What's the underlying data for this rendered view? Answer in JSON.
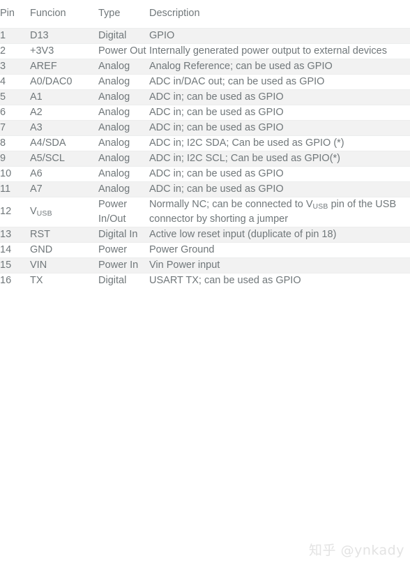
{
  "table": {
    "name": "arduino-pin-description-table",
    "columns": [
      {
        "key": "pin",
        "label": "Pin"
      },
      {
        "key": "func",
        "label": "Funcion"
      },
      {
        "key": "type",
        "label": "Type"
      },
      {
        "key": "desc",
        "label": "Description"
      }
    ],
    "rows": [
      {
        "pin": "1",
        "func": "D13",
        "type": "Digital",
        "desc": "GPIO"
      },
      {
        "pin": "2",
        "func": "+3V3",
        "type": "Power Out",
        "desc": "Internally generated power output to external devices"
      },
      {
        "pin": "3",
        "func": "AREF",
        "type": "Analog",
        "desc": "Analog Reference; can be used as GPIO"
      },
      {
        "pin": "4",
        "func": "A0/DAC0",
        "type": "Analog",
        "desc": "ADC in/DAC out; can be used as GPIO"
      },
      {
        "pin": "5",
        "func": "A1",
        "type": "Analog",
        "desc": "ADC in; can be used as GPIO"
      },
      {
        "pin": "6",
        "func": "A2",
        "type": "Analog",
        "desc": "ADC in; can be used as GPIO"
      },
      {
        "pin": "7",
        "func": "A3",
        "type": "Analog",
        "desc": "ADC in; can be used as GPIO"
      },
      {
        "pin": "8",
        "func": "A4/SDA",
        "type": "Analog",
        "desc": "ADC in; I2C SDA; Can be used as GPIO (*)"
      },
      {
        "pin": "9",
        "func": "A5/SCL",
        "type": "Analog",
        "desc": "ADC in; I2C SCL; Can be used as GPIO(*)"
      },
      {
        "pin": "10",
        "func": "A6",
        "type": "Analog",
        "desc": "ADC in; can be used as GPIO"
      },
      {
        "pin": "11",
        "func": "A7",
        "type": "Analog",
        "desc": "ADC in; can be used as GPIO"
      },
      {
        "pin": "12",
        "func": "VUSB",
        "func_base": "V",
        "func_sub": "USB",
        "type": "Power In/Out",
        "desc": "Normally NC; can be connected to VUSB pin of the USB connector by shorting a jumper",
        "desc_part1": "Normally NC; can be connected to V",
        "desc_sub": "USB",
        "desc_part2": " pin of the USB connector by shorting a jumper"
      },
      {
        "pin": "13",
        "func": "RST",
        "type": "Digital In",
        "desc": "Active low reset input (duplicate of pin 18)"
      },
      {
        "pin": "14",
        "func": "GND",
        "type": "Power",
        "desc": "Power Ground"
      },
      {
        "pin": "15",
        "func": "VIN",
        "type": "Power In",
        "desc": "Vin Power input"
      },
      {
        "pin": "16",
        "func": "TX",
        "type": "Digital",
        "desc": "USART TX; can be used as GPIO"
      }
    ]
  },
  "watermark": {
    "text": "知乎 @ynkady",
    "color": "#e3e3e3"
  },
  "style": {
    "text_color": "#70777a",
    "alt_row_background": "#f2f2f2",
    "row_background": "#ffffff",
    "row_border_color": "#eceded"
  }
}
